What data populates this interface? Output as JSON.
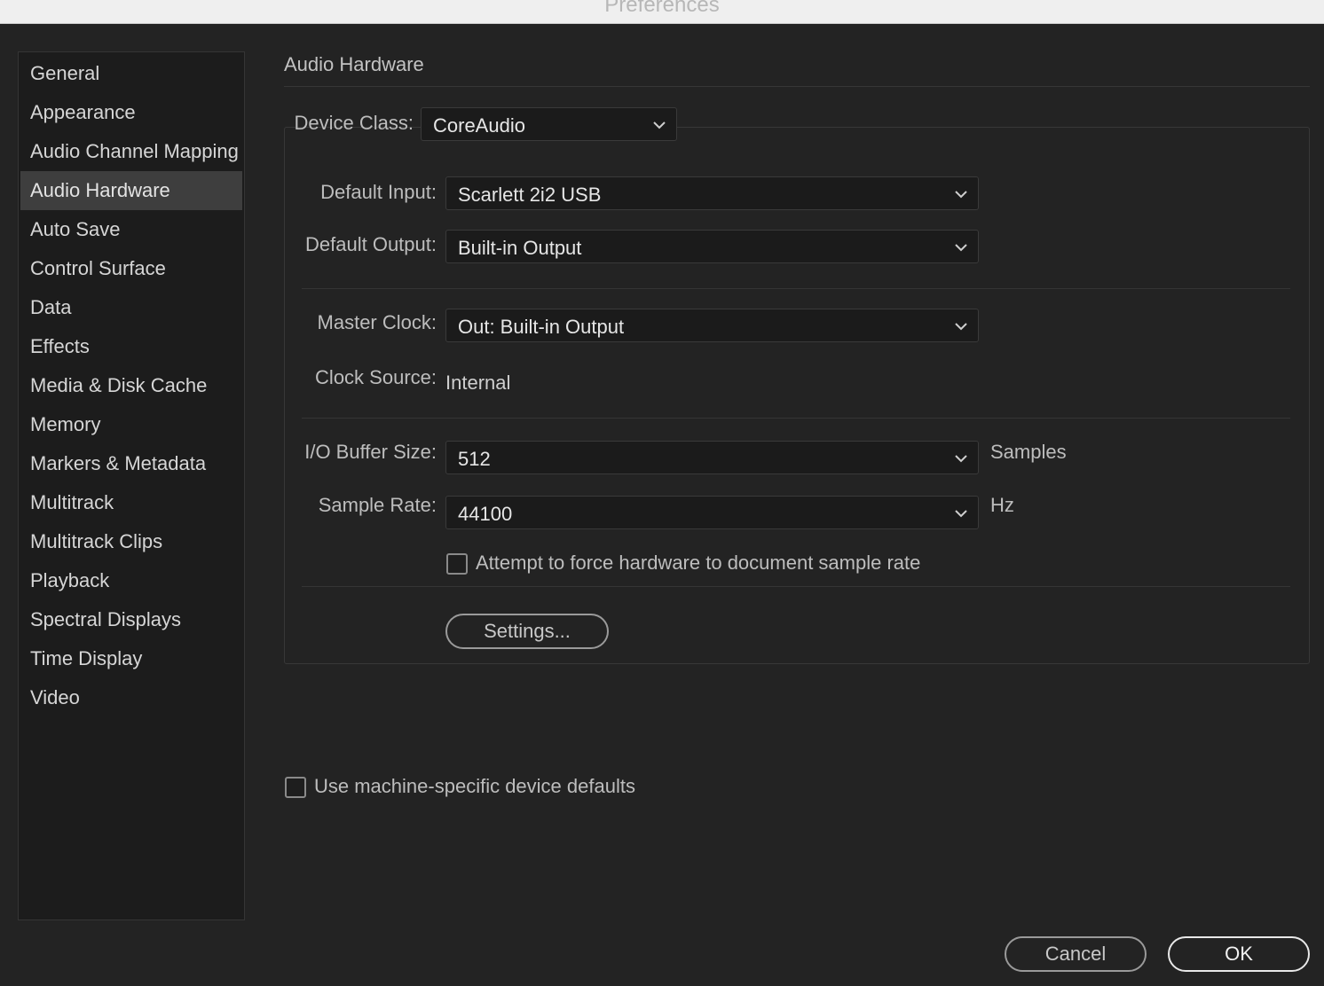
{
  "window": {
    "title": "Preferences"
  },
  "sidebar": {
    "items": [
      {
        "label": "General",
        "selected": false
      },
      {
        "label": "Appearance",
        "selected": false
      },
      {
        "label": "Audio Channel Mapping",
        "selected": false
      },
      {
        "label": "Audio Hardware",
        "selected": true
      },
      {
        "label": "Auto Save",
        "selected": false
      },
      {
        "label": "Control Surface",
        "selected": false
      },
      {
        "label": "Data",
        "selected": false
      },
      {
        "label": "Effects",
        "selected": false
      },
      {
        "label": "Media & Disk Cache",
        "selected": false
      },
      {
        "label": "Memory",
        "selected": false
      },
      {
        "label": "Markers & Metadata",
        "selected": false
      },
      {
        "label": "Multitrack",
        "selected": false
      },
      {
        "label": "Multitrack Clips",
        "selected": false
      },
      {
        "label": "Playback",
        "selected": false
      },
      {
        "label": "Spectral Displays",
        "selected": false
      },
      {
        "label": "Time Display",
        "selected": false
      },
      {
        "label": "Video",
        "selected": false
      }
    ]
  },
  "main": {
    "section_title": "Audio Hardware",
    "device_class": {
      "label": "Device Class:",
      "value": "CoreAudio"
    },
    "default_input": {
      "label": "Default Input:",
      "value": "Scarlett 2i2 USB"
    },
    "default_output": {
      "label": "Default Output:",
      "value": "Built-in Output"
    },
    "master_clock": {
      "label": "Master Clock:",
      "value": "Out: Built-in Output"
    },
    "clock_source": {
      "label": "Clock Source:",
      "value": "Internal"
    },
    "io_buffer_size": {
      "label": "I/O Buffer Size:",
      "value": "512",
      "unit": "Samples"
    },
    "sample_rate": {
      "label": "Sample Rate:",
      "value": "44100",
      "unit": "Hz"
    },
    "force_sample_rate": {
      "label": "Attempt to force hardware to document sample rate",
      "checked": false
    },
    "settings_button": "Settings...",
    "machine_defaults": {
      "label": "Use machine-specific device defaults",
      "checked": false
    }
  },
  "footer": {
    "cancel": "Cancel",
    "ok": "OK"
  },
  "colors": {
    "background": "#232323",
    "sidebar_bg": "#1c1c1c",
    "selected_item": "#3e3e3e",
    "text": "#c8c8c8"
  },
  "icons": {
    "dropdown": "chevron-down-icon"
  }
}
